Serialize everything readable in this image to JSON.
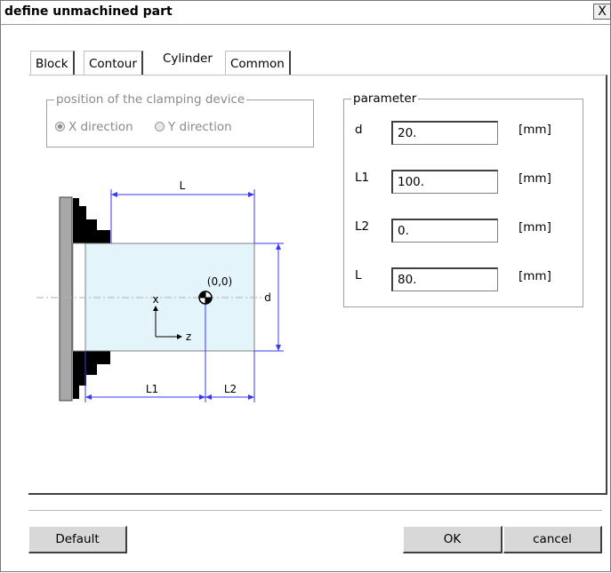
{
  "window": {
    "title": "define unmachined part",
    "close_glyph": "X"
  },
  "tabs": [
    {
      "label": "Block",
      "active": false
    },
    {
      "label": "Contour",
      "active": false
    },
    {
      "label": "Cylinder",
      "active": true
    },
    {
      "label": "Common",
      "active": false
    }
  ],
  "clamping": {
    "legend": "position of the clamping device",
    "options": [
      {
        "label": "X direction",
        "selected": true
      },
      {
        "label": "Y direction",
        "selected": false
      }
    ]
  },
  "parameter": {
    "legend": "parameter",
    "rows": [
      {
        "label": "d",
        "value": "20.",
        "unit": "[mm]"
      },
      {
        "label": "L1",
        "value": "100.",
        "unit": "[mm]"
      },
      {
        "label": "L2",
        "value": "0.",
        "unit": "[mm]"
      },
      {
        "label": "L",
        "value": "80.",
        "unit": "[mm]"
      }
    ]
  },
  "diagram": {
    "labels": {
      "L": "L",
      "d": "d",
      "L1": "L1",
      "L2": "L2",
      "origin": "(0,0)",
      "x_axis": "x",
      "z_axis": "z"
    }
  },
  "buttons": {
    "default": "Default",
    "ok": "OK",
    "cancel": "cancel"
  },
  "colors": {
    "part_fill": "#e3f4fa",
    "dimension_blue": "#3a3af0",
    "chuck": "#000000"
  }
}
